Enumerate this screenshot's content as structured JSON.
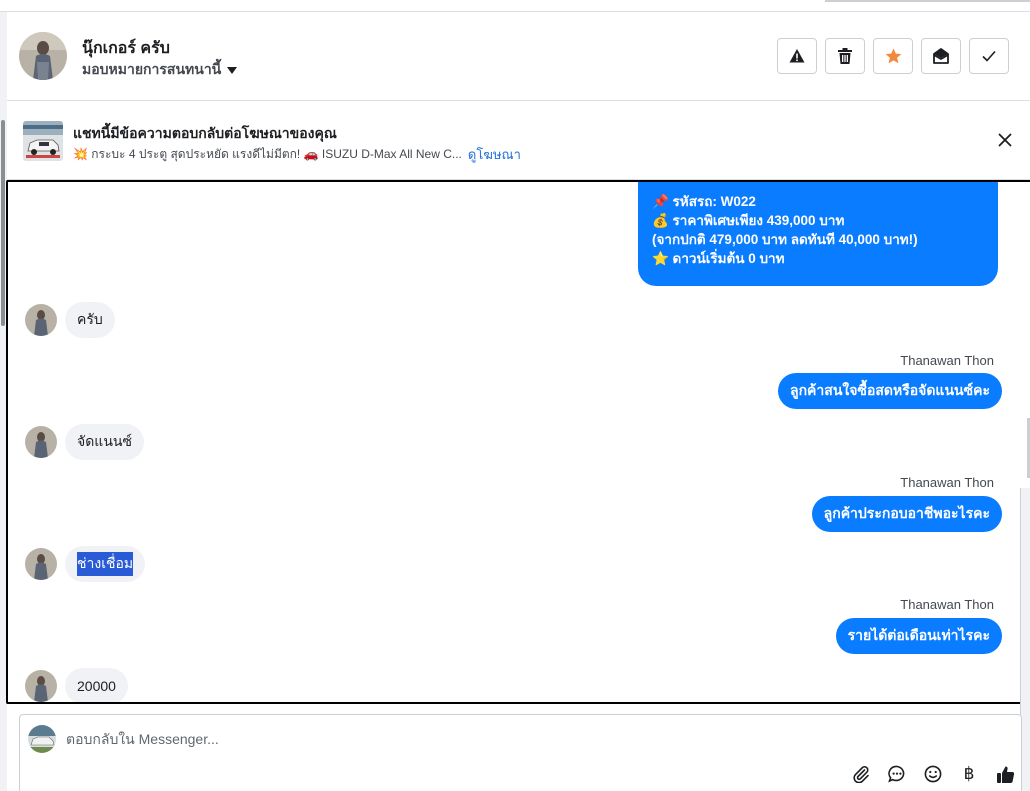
{
  "header": {
    "name": "นุ๊กเกอร์ ครับ",
    "assign_label": "มอบหมายการสนทนานี้",
    "actions": [
      {
        "icon": "warning-icon",
        "color": "#1c1e21"
      },
      {
        "icon": "trash-icon",
        "color": "#1c1e21"
      },
      {
        "icon": "star-icon",
        "color": "#f5893a"
      },
      {
        "icon": "open-envelope-icon",
        "color": "#1c1e21"
      },
      {
        "icon": "checkmark-icon",
        "color": "#1c1e21"
      }
    ]
  },
  "ad_banner": {
    "title": "แชทนี้มีข้อความตอบกลับต่อโฆษณาของคุณ",
    "text": "💥 กระบะ 4 ประตู สุดประหยัด แรงดีไม่มีตก! 🚗 ISUZU D-Max All New C...",
    "link": "ดูโฆษณา"
  },
  "messages": {
    "ad_reply_lines": [
      "📌 รหัสรถ: W022",
      "💰 ราคาพิเศษเพียง 439,000 บาท",
      "(จากปกติ 479,000 บาท ลดทันที 40,000 บาท!)",
      "⭐ ดาวน์เริ่มต้น 0 บาท"
    ],
    "in_1": "ครับ",
    "sender_1": "Thanawan Thon",
    "out_1": "ลูกค้าสนใจซื้อสดหรือจัดแนนซ์คะ",
    "in_2": "จัดแนนซ์",
    "sender_2": "Thanawan Thon",
    "out_2": "ลูกค้าประกอบอาชีพอะไรคะ",
    "in_3": "ช่างเชื่อม",
    "sender_3": "Thanawan Thon",
    "out_3": "รายได้ต่อเดือนเท่าไรคะ",
    "in_4": "20000"
  },
  "composer": {
    "placeholder": "ตอบกลับใน Messenger...",
    "currency_symbol": "฿"
  },
  "colors": {
    "accent": "#0a7cff",
    "star": "#f5893a",
    "link": "#216fdb",
    "incoming_bubble": "#f0f2f5"
  }
}
